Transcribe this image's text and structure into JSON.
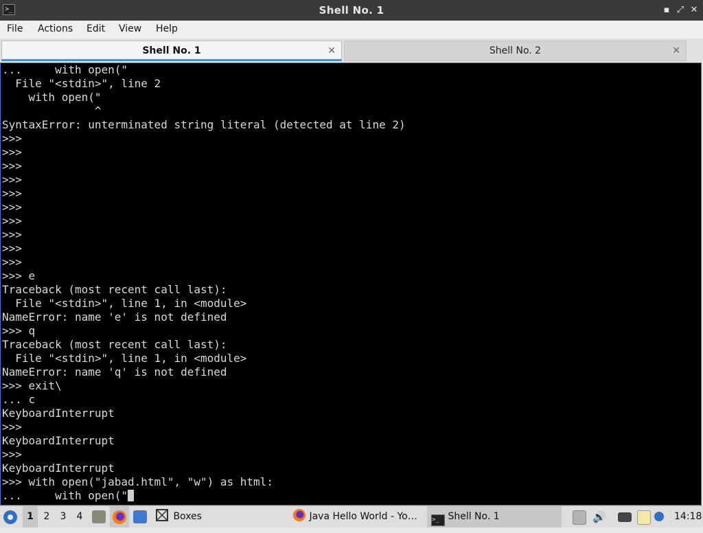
{
  "window": {
    "title": "Shell No. 1",
    "app_icon": ">_",
    "controls": {
      "minimize": "▪",
      "maximize": "⤢",
      "close": "✕"
    }
  },
  "menu": [
    "File",
    "Actions",
    "Edit",
    "View",
    "Help"
  ],
  "tabs": [
    {
      "label": "Shell No. 1",
      "close": "✕"
    },
    {
      "label": "Shell No. 2",
      "close": "✕"
    }
  ],
  "terminal": {
    "lines": [
      "...     with open(\"",
      "  File \"<stdin>\", line 2",
      "    with open(\"",
      "              ^",
      "SyntaxError: unterminated string literal (detected at line 2)",
      ">>>",
      ">>>",
      ">>>",
      ">>>",
      ">>>",
      ">>>",
      ">>>",
      ">>>",
      ">>>",
      ">>>",
      ">>> e",
      "Traceback (most recent call last):",
      "  File \"<stdin>\", line 1, in <module>",
      "NameError: name 'e' is not defined",
      ">>> q",
      "Traceback (most recent call last):",
      "  File \"<stdin>\", line 1, in <module>",
      "NameError: name 'q' is not defined",
      ">>> exit\\",
      "... c",
      "KeyboardInterrupt",
      ">>>",
      "KeyboardInterrupt",
      ">>>",
      "KeyboardInterrupt",
      ">>> with open(\"jabad.html\", \"w\") as html:",
      "...     with open(\""
    ],
    "colors": {
      "background": "#000000",
      "text": "#d9d9d9",
      "border": "#3a7bd5"
    }
  },
  "taskbar": {
    "workspaces": [
      "1",
      "2",
      "3",
      "4"
    ],
    "active_workspace": "1",
    "launchers": [
      "start-menu-icon",
      "file-manager-icon",
      "firefox-icon",
      "show-desktop-icon"
    ],
    "tasks": [
      {
        "label": "Boxes",
        "icon": "boxes-icon"
      },
      {
        "label": "Java Hello World - Yo…",
        "icon": "firefox-icon"
      },
      {
        "label": "Shell No. 1",
        "icon": "terminal-icon"
      }
    ],
    "tray": [
      "clipboard-icon",
      "volume-icon",
      "network-icon",
      "notes-icon",
      "update-icon"
    ],
    "clock": "14:18"
  }
}
